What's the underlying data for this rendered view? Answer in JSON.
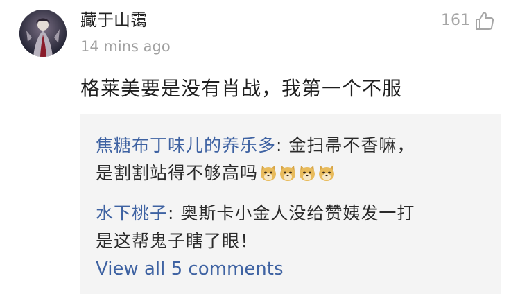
{
  "comment": {
    "username": "藏于山霭",
    "timestamp": "14 mins ago",
    "like_count": "161",
    "text": "格莱美要是没有肖战，我第一个不服"
  },
  "replies": [
    {
      "author": "焦糖布丁味儿的养乐多",
      "separator": ": ",
      "text_line1": "金扫帚不香嘛，",
      "text_line2": "是割割站得不够高吗",
      "emoji_icon": "doge-emoji",
      "emoji_count": 4
    },
    {
      "author": "水下桃子",
      "separator": ": ",
      "text_line1": "奥斯卡小金人没给赞姨发一打",
      "text_line2": "是这帮鬼子瞎了眼！"
    }
  ],
  "view_all_label": "View all 5 comments",
  "colors": {
    "link_blue": "#3e62a2",
    "reply_background": "#f4f4f4",
    "muted_text": "#a0a0a0"
  }
}
